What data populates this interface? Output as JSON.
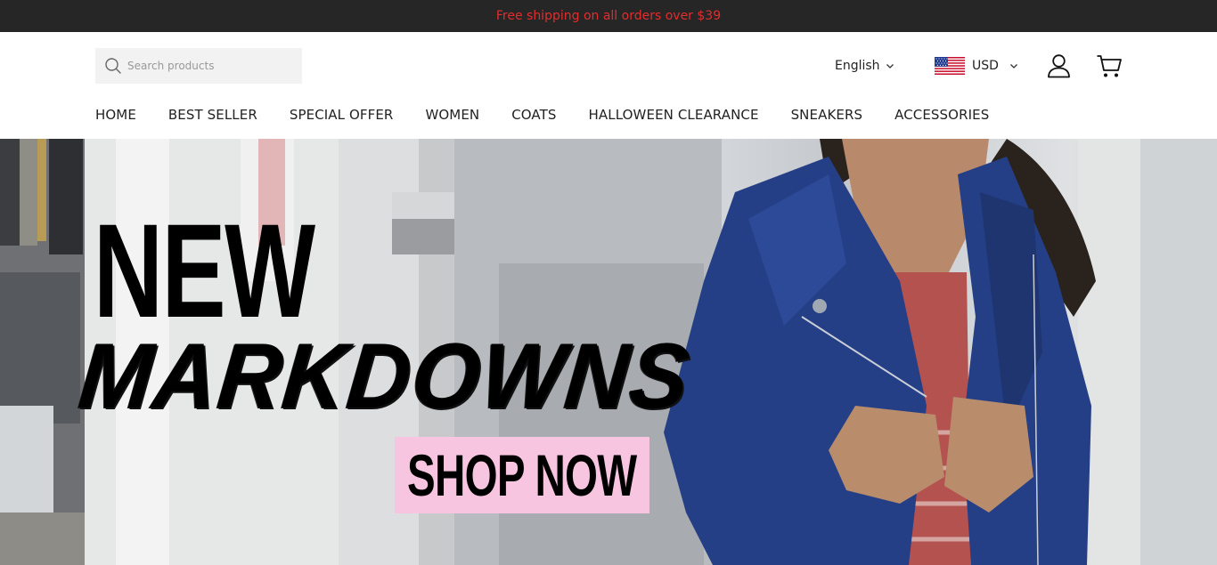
{
  "announcement": {
    "text": "Free shipping on all orders over $39",
    "color": "#e32d2d"
  },
  "header": {
    "search": {
      "placeholder": "Search products",
      "icon": "search-icon"
    },
    "language": {
      "label": "English",
      "icon": "chevron-down-icon"
    },
    "currency": {
      "label": "USD",
      "flag": "us-flag-icon",
      "icon": "chevron-down-icon"
    },
    "account": {
      "icon": "user-icon"
    },
    "cart": {
      "icon": "cart-icon"
    }
  },
  "nav": {
    "items": [
      {
        "label": "HOME"
      },
      {
        "label": "BEST SELLER"
      },
      {
        "label": "SPECIAL OFFER"
      },
      {
        "label": "WOMEN"
      },
      {
        "label": "COATS"
      },
      {
        "label": "HALLOWEEN CLEARANCE"
      },
      {
        "label": "SNEAKERS"
      },
      {
        "label": "ACCESSORIES"
      }
    ]
  },
  "hero": {
    "headline_line1": "NEW",
    "headline_line2": "MARKDOWNS",
    "cta_label": "SHOP NOW",
    "cta_color": "#f7c5e0",
    "jacket_color": "#253f86"
  }
}
